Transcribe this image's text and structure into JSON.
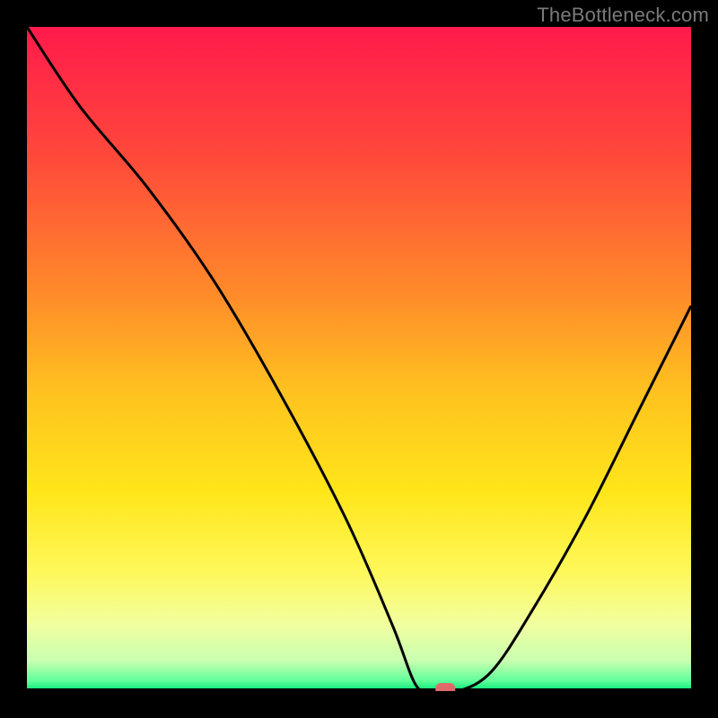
{
  "watermark": "TheBottleneck.com",
  "chart_data": {
    "type": "line",
    "title": "",
    "xlabel": "",
    "ylabel": "",
    "xlim": [
      0,
      100
    ],
    "ylim": [
      0,
      100
    ],
    "series": [
      {
        "name": "bottleneck-curve",
        "x": [
          0,
          8,
          18,
          28,
          38,
          48,
          55,
          58.5,
          61,
          65,
          70,
          76,
          84,
          92,
          100
        ],
        "y": [
          100,
          88,
          76,
          62,
          45,
          26,
          10,
          1,
          0,
          0,
          3,
          12,
          26,
          42,
          58
        ]
      }
    ],
    "marker": {
      "x": 63,
      "y": 0
    },
    "gradient_stops": [
      {
        "offset": 0.0,
        "color": "#ff1a4b"
      },
      {
        "offset": 0.2,
        "color": "#ff4a3a"
      },
      {
        "offset": 0.4,
        "color": "#ff8a2a"
      },
      {
        "offset": 0.55,
        "color": "#ffc21f"
      },
      {
        "offset": 0.7,
        "color": "#ffe61a"
      },
      {
        "offset": 0.82,
        "color": "#fff85a"
      },
      {
        "offset": 0.9,
        "color": "#f1ffa0"
      },
      {
        "offset": 0.955,
        "color": "#c8ffb0"
      },
      {
        "offset": 0.985,
        "color": "#5eff9a"
      },
      {
        "offset": 1.0,
        "color": "#00e676"
      }
    ]
  }
}
